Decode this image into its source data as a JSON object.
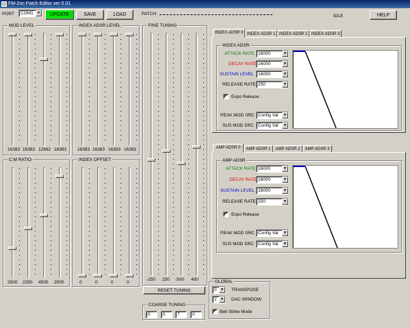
{
  "window": {
    "title": "FM-2sn Patch Editor ver 0.01"
  },
  "toolbar": {
    "port_label": "PORT",
    "port_value": "COM1",
    "update_label": "UPDATE",
    "save_label": "SAVE",
    "load_label": "LOAD",
    "patch_label": "PATCH:",
    "status": "IDLE",
    "help_label": "HELP"
  },
  "mod_level": {
    "title": "MOD LEVEL",
    "values": [
      "16383",
      "16383",
      "12662",
      "16383"
    ]
  },
  "index_adsr_level": {
    "title": "INDEX ADSR LEVEL",
    "values": [
      "16383",
      "16383",
      "16383",
      "16383"
    ]
  },
  "cm_ratio": {
    "title": "C:M RATIO",
    "values": [
      "2500",
      "2250",
      "4500",
      "2500"
    ]
  },
  "index_offset": {
    "title": "INDEX OFFSET",
    "values": [
      "0",
      "0",
      "0",
      "0"
    ]
  },
  "fine_tuning": {
    "title": "FINE TUNING",
    "values": [
      "-250",
      "250",
      "-500",
      "400"
    ],
    "reset_label": "RESET TUNING"
  },
  "coarse_tuning": {
    "title": "COARSE TUNING",
    "values": [
      "0",
      "0",
      "7",
      "0"
    ]
  },
  "global": {
    "title": "GLOBAL",
    "transpose_value": "0",
    "transpose_label": "TRANSPOSE",
    "dac_window_value": "2",
    "dac_window_label": "DAC WINDOW",
    "bell_strike_label": "Bell Strike Mode",
    "bell_strike_checked": "✔"
  },
  "index_adsr_tabs": [
    "INDEX ADSR 0",
    "INDEX ADSR 1",
    "INDEX ADSR 2",
    "INDEX ADSR 3"
  ],
  "amp_adsr_tabs": [
    "AMP ADSR 0",
    "AMP ADSR 1",
    "AMP ADSR 2",
    "AMP ADSR 3"
  ],
  "index_adsr": {
    "title": "INDEX ADSR",
    "attack_label": "ATTACK RATE",
    "attack_value": "16000",
    "decay_label": "DECAY RATE",
    "decay_value": "16000",
    "sustain_label": "SUSTAIN LEVEL",
    "sustain_value": "16000",
    "release_label": "RELEASE RATE",
    "release_value": "250",
    "expo_label": "Expo Release",
    "expo_checked": "✔",
    "peak_label": "PEAK MOD SRC",
    "peak_value": "Config Val",
    "sus_label": "SUS MOD SRC",
    "sus_value": "Config Val"
  },
  "amp_adsr": {
    "title": "AMP ADSR",
    "attack_label": "ATTACK RATE",
    "attack_value": "16000",
    "decay_label": "DECAY RATE",
    "decay_value": "16000",
    "sustain_label": "SUSTAIN LEVEL",
    "sustain_value": "16000",
    "release_label": "RELEASE RATE",
    "release_value": "250",
    "expo_label": "Expo Release",
    "expo_checked": "✔",
    "peak_label": "PEAK MOD SRC",
    "peak_value": "Config Val",
    "sus_label": "SUS MOD SRC",
    "sus_value": "Config Val"
  },
  "colors": {
    "attack": "#008000",
    "decay": "#e00000",
    "sustain": "#0000c0",
    "update_button": "#00e000"
  }
}
